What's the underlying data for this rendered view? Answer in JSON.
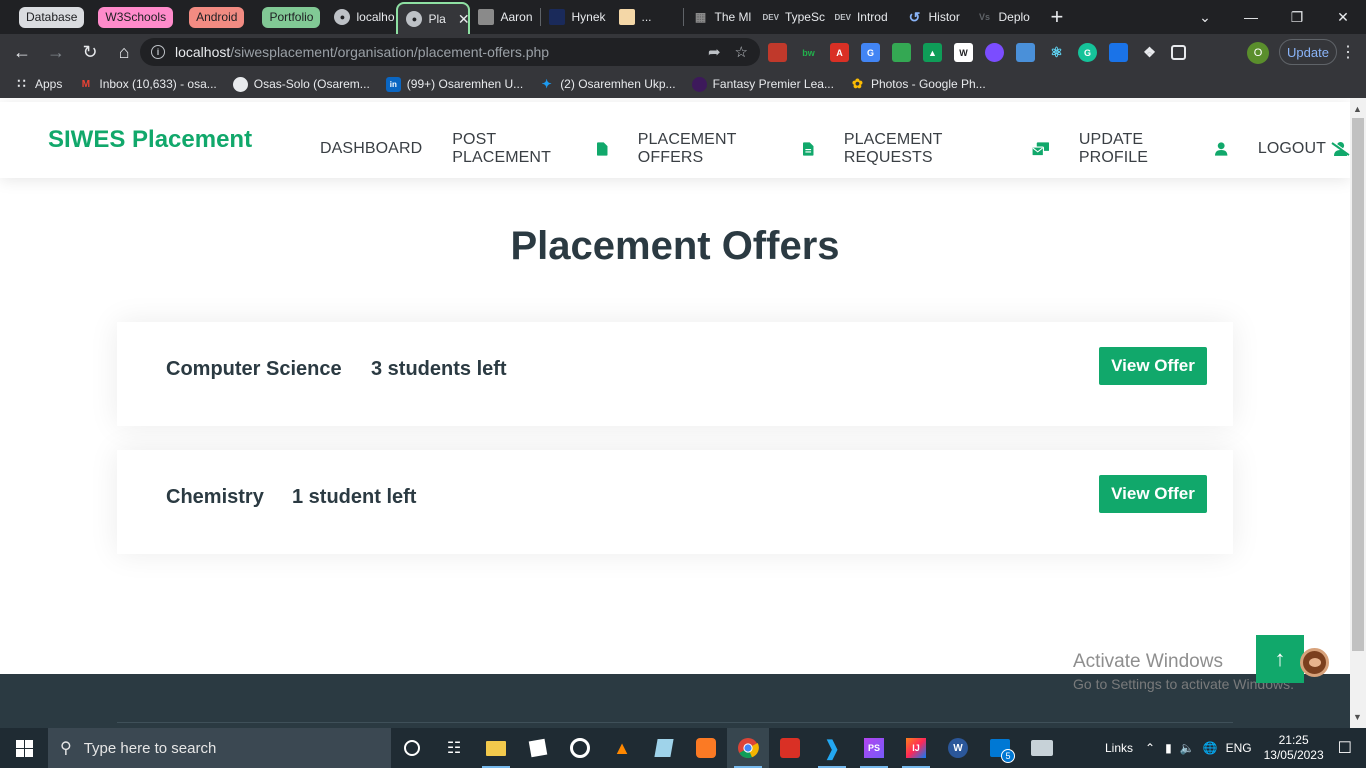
{
  "browser": {
    "tab_groups": [
      {
        "label": "Database",
        "color": "#dadce0"
      },
      {
        "label": "W3Schools",
        "color": "#ff8bcb"
      },
      {
        "label": "Android",
        "color": "#f28b82"
      },
      {
        "label": "Portfolio",
        "color": "#81c995"
      }
    ],
    "tabs": [
      {
        "title": "localho",
        "icon": "globe-icon"
      },
      {
        "title": "Pla",
        "icon": "globe-icon",
        "active": true
      },
      {
        "title": "Aaron",
        "icon": "avatar-icon"
      },
      {
        "title": "Hynek",
        "icon": "hynek-icon"
      },
      {
        "title": "...",
        "icon": "face-icon"
      },
      {
        "title": "The Ml",
        "icon": "tab-icon"
      },
      {
        "title": "TypeSc",
        "icon": "dev-icon"
      },
      {
        "title": "Introd",
        "icon": "dev-icon"
      },
      {
        "title": "Histor",
        "icon": "history-icon"
      },
      {
        "title": "Deplo",
        "icon": "vs-icon"
      }
    ],
    "url_host": "localhost",
    "url_path": "/siwesplacement/organisation/placement-offers.php",
    "profile_initial": "O",
    "update_label": "Update",
    "bookmarks": [
      {
        "label": "Apps",
        "icon": "apps-grid-icon"
      },
      {
        "label": "Inbox (10,633) - osa...",
        "icon": "gmail-icon"
      },
      {
        "label": "Osas-Solo (Osarem...",
        "icon": "github-icon"
      },
      {
        "label": "(99+) Osaremhen U...",
        "icon": "linkedin-icon"
      },
      {
        "label": "(2) Osaremhen Ukp...",
        "icon": "twitter-icon"
      },
      {
        "label": "Fantasy Premier Lea...",
        "icon": "premier-league-icon"
      },
      {
        "label": "Photos - Google Ph...",
        "icon": "google-photos-icon"
      }
    ]
  },
  "site": {
    "logo": "SIWES Placement",
    "nav": [
      {
        "label": "DASHBOARD",
        "icon": ""
      },
      {
        "label": "POST PLACEMENT",
        "icon": "file-icon"
      },
      {
        "label": "PLACEMENT OFFERS",
        "icon": "file-lines-icon"
      },
      {
        "label": "PLACEMENT REQUESTS",
        "icon": "envelopes-icon"
      },
      {
        "label": "UPDATE PROFILE",
        "icon": "user-icon"
      },
      {
        "label": "LOGOUT",
        "icon": "user-slash-icon"
      }
    ],
    "page_title": "Placement Offers",
    "offers": [
      {
        "field": "Computer Science",
        "remaining": "3 students left",
        "button": "View Offer"
      },
      {
        "field": "Chemistry",
        "remaining": "1 student left",
        "button": "View Offer"
      }
    ],
    "accent": "#11a86b"
  },
  "watermark": {
    "line1": "Activate Windows",
    "line2": "Go to Settings to activate Windows."
  },
  "taskbar": {
    "search_placeholder": "Type here to search",
    "links_label": "Links",
    "language": "ENG",
    "time": "21:25",
    "date": "13/05/2023",
    "badge_count": "5"
  }
}
